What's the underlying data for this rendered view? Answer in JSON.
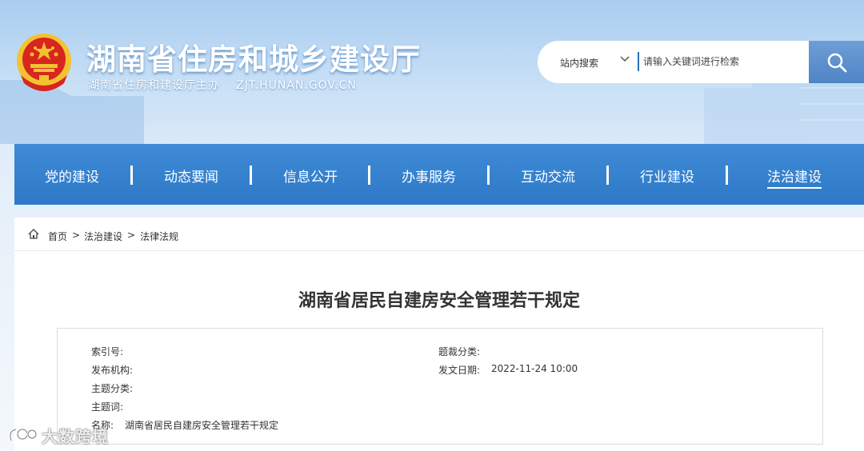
{
  "header": {
    "title": "湖南省住房和城乡建设厅",
    "subtitle": "湖南省住房和建设厅主办",
    "domain": "ZJT.HUNAN.GOV.CN"
  },
  "search": {
    "scope": "站内搜索",
    "placeholder": "请输入关键词进行检索"
  },
  "nav": {
    "items": [
      "党的建设",
      "动态要闻",
      "信息公开",
      "办事服务",
      "互动交流",
      "行业建设",
      "法治建设"
    ],
    "active": "法治建设"
  },
  "breadcrumb": {
    "home": "首页",
    "sep": ">",
    "level1": "法治建设",
    "level2": "法律法规"
  },
  "article": {
    "title": "湖南省居民自建房安全管理若干规定"
  },
  "meta": {
    "index_label": "索引号:",
    "index_value": "",
    "category_label": "题裁分类:",
    "category_value": "",
    "publisher_label": "发布机构:",
    "publisher_value": "",
    "date_label": "发文日期:",
    "date_value": "2022-11-24 10:00",
    "topic_label": "主题分类:",
    "topic_value": "",
    "keywords_label": "主题词:",
    "keywords_value": "",
    "name_label": "名称:",
    "name_value": "湖南省居民自建房安全管理若干规定"
  },
  "watermark": {
    "text": "大数跨境"
  },
  "colors": {
    "nav_blue": "#2d79c7",
    "search_button": "#4f84c6",
    "emblem_red": "#d7261e",
    "emblem_gold": "#f2c230"
  }
}
